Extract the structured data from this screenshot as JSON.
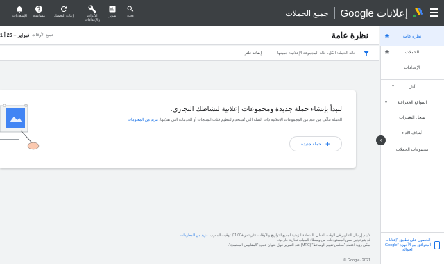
{
  "topbar": {
    "brand_title": "إعلانات Google",
    "brand_sub": "جميع الحملات",
    "actions": [
      {
        "label": "بحث",
        "icon": "search-icon"
      },
      {
        "label": "تقرير",
        "icon": "reports-icon"
      },
      {
        "label": "الأدوات والإعدادات",
        "icon": "tools-icon"
      },
      {
        "label": "إعادة التحميل",
        "icon": "refresh-icon"
      },
      {
        "label": "مساعدة",
        "icon": "help-icon"
      },
      {
        "label": "الإشعارات",
        "icon": "notifications-icon"
      }
    ]
  },
  "header": {
    "title": "نظرة عامة",
    "date_range": "1 فبراير – 25 أ",
    "all_time": "جميع الأوقات"
  },
  "filter": {
    "text": "حالة الحملة: الكل، حالة المجموعة الإعلانية: جميعها",
    "add": "إضافة فلتر"
  },
  "sidebar": {
    "items": [
      "نظرة عامة",
      "الحملات",
      "الإعدادات",
      "أقل",
      "المواقع الجغرافية",
      "سجل التغييرات",
      "أهداف الأداء",
      "مجموعات الحملات"
    ],
    "promo": "الحصول على تطبيق \"إعلانات Google\" المتوافق مع الأجهزة الجوالة"
  },
  "card": {
    "title": "لنبدأ بإنشاء حملة جديدة ومجموعات إعلانية لنشاطك التجاري.",
    "desc": "الحملة تتألّف من عدد من المجموعات الإعلانية ذات الصلة التي تُستخدم لتنظيم فئات المنتجات أو الخدمات التي تقدّمها.",
    "link": "مزيد من المعلومات",
    "button": "حملة جديدة"
  },
  "footer": {
    "line1": "لا يتم إرسال التقارير في الوقت الفعلي. المنطقة الزمنية لجميع التواريخ والأوقات: (غرينتش+01:00) توقيت المغرب.",
    "line1_link": "مزيد من المعلومات",
    "line2": "قد يتم توفير بعض المستودعات من وسطاء لأسباب تجارية خارجية.",
    "line3": "يمكن رؤية اعتماد \"مجلس تقييم الوسائط\" (MRC) عند التمرير فوق عنوان عمود \"المقاييس المعتمدة\".",
    "copyright": "© Google، 2021"
  },
  "colors": {
    "topbar": "#3c4043",
    "accent": "#1a73e8"
  }
}
